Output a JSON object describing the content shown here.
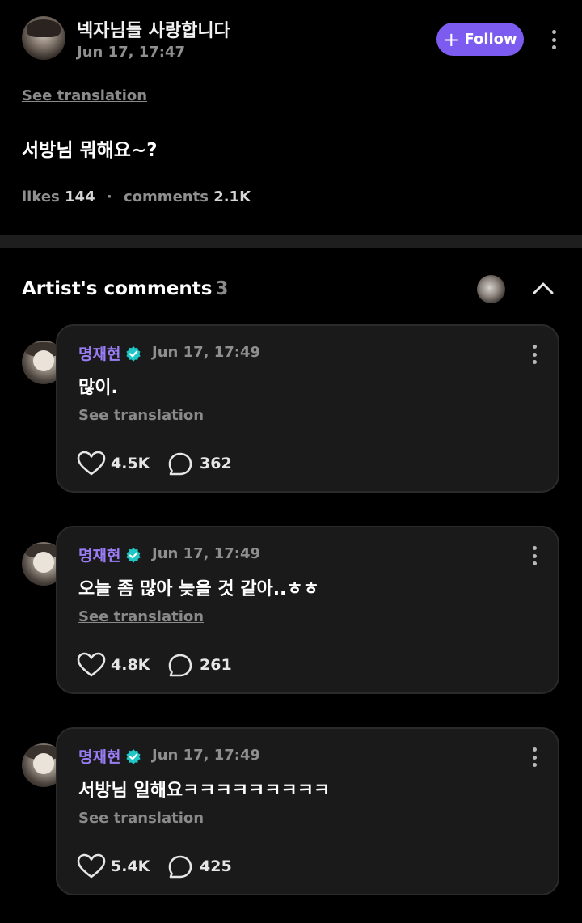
{
  "post": {
    "author_name": "넥자님들 사랑합니다",
    "date": "Jun 17, 17:47",
    "follow_label": "Follow",
    "see_translation": "See translation",
    "text": "서방님 뭐해요~?",
    "likes_label": "likes",
    "likes_count": "144",
    "comments_label": "comments",
    "comments_count": "2.1K"
  },
  "artist_comments": {
    "title": "Artist's comments",
    "count": "3",
    "accent_color": "#7c5cf0",
    "verified_color": "#1fc6c6",
    "items": [
      {
        "name": "명재현",
        "date": "Jun 17, 17:49",
        "text": "많이.",
        "see_translation": "See translation",
        "likes": "4.5K",
        "replies": "362"
      },
      {
        "name": "명재현",
        "date": "Jun 17, 17:49",
        "text": "오늘 좀 많아 늦을 것 같아..ㅎㅎ",
        "see_translation": "See translation",
        "likes": "4.8K",
        "replies": "261"
      },
      {
        "name": "명재현",
        "date": "Jun 17, 17:49",
        "text": "서방님 일해요ㅋㅋㅋㅋㅋㅋㅋㅋㅋ",
        "see_translation": "See translation",
        "likes": "5.4K",
        "replies": "425"
      }
    ]
  },
  "icons": {
    "follow": "plus-icon",
    "more": "kebab-menu-icon",
    "collapse": "chevron-up-icon",
    "like": "heart-icon",
    "reply": "comment-bubble-icon",
    "verified": "verified-badge-icon"
  }
}
